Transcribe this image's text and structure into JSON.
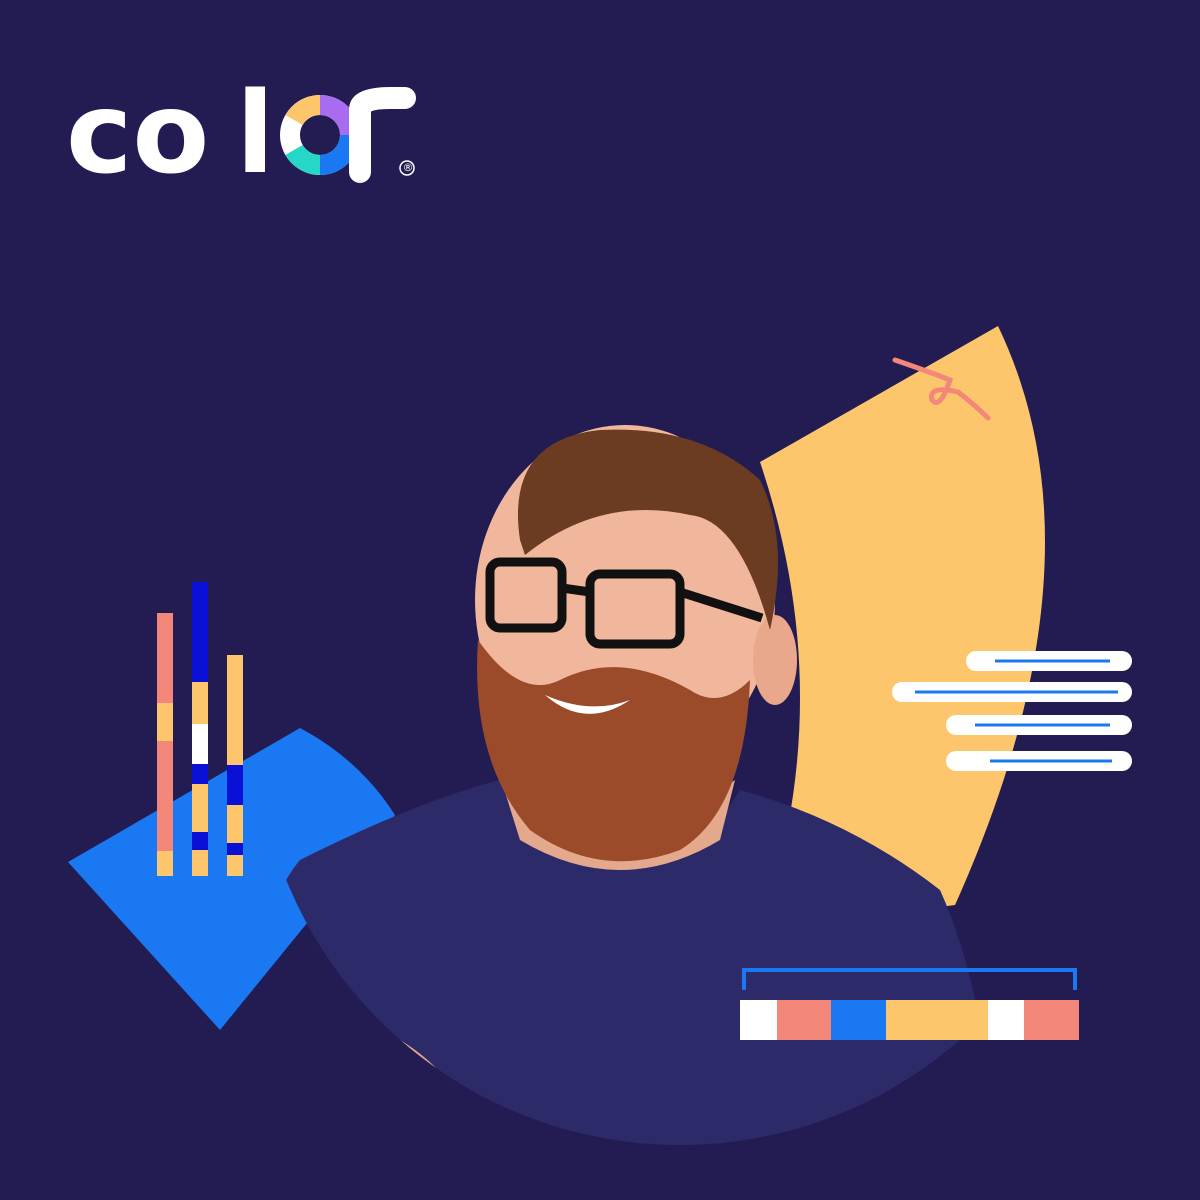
{
  "brand": {
    "name": "color",
    "registered_mark": "®"
  },
  "colors": {
    "background": "#221c52",
    "brand_yellow": "#fdc66c",
    "brand_blue": "#1a78f2",
    "brand_deep_blue": "#0a10d6",
    "brand_coral": "#f3877a",
    "brand_purple": "#a76cf0",
    "brand_teal": "#26d6c6",
    "white": "#ffffff",
    "shirt_navy": "#2c2a68",
    "skin": "#f0b79c",
    "beard": "#9b4a2a",
    "hair": "#6b3b22"
  },
  "icons": {
    "logo_o": "donut-segment-icon",
    "registered": "registered-trademark-icon"
  },
  "illustration": {
    "vertical_bars_icon": "striped-vertical-bars",
    "text_lines_icon": "text-lines-pills",
    "color_strip_icon": "color-segment-strip",
    "person": "smiling-bearded-man-with-glasses"
  }
}
